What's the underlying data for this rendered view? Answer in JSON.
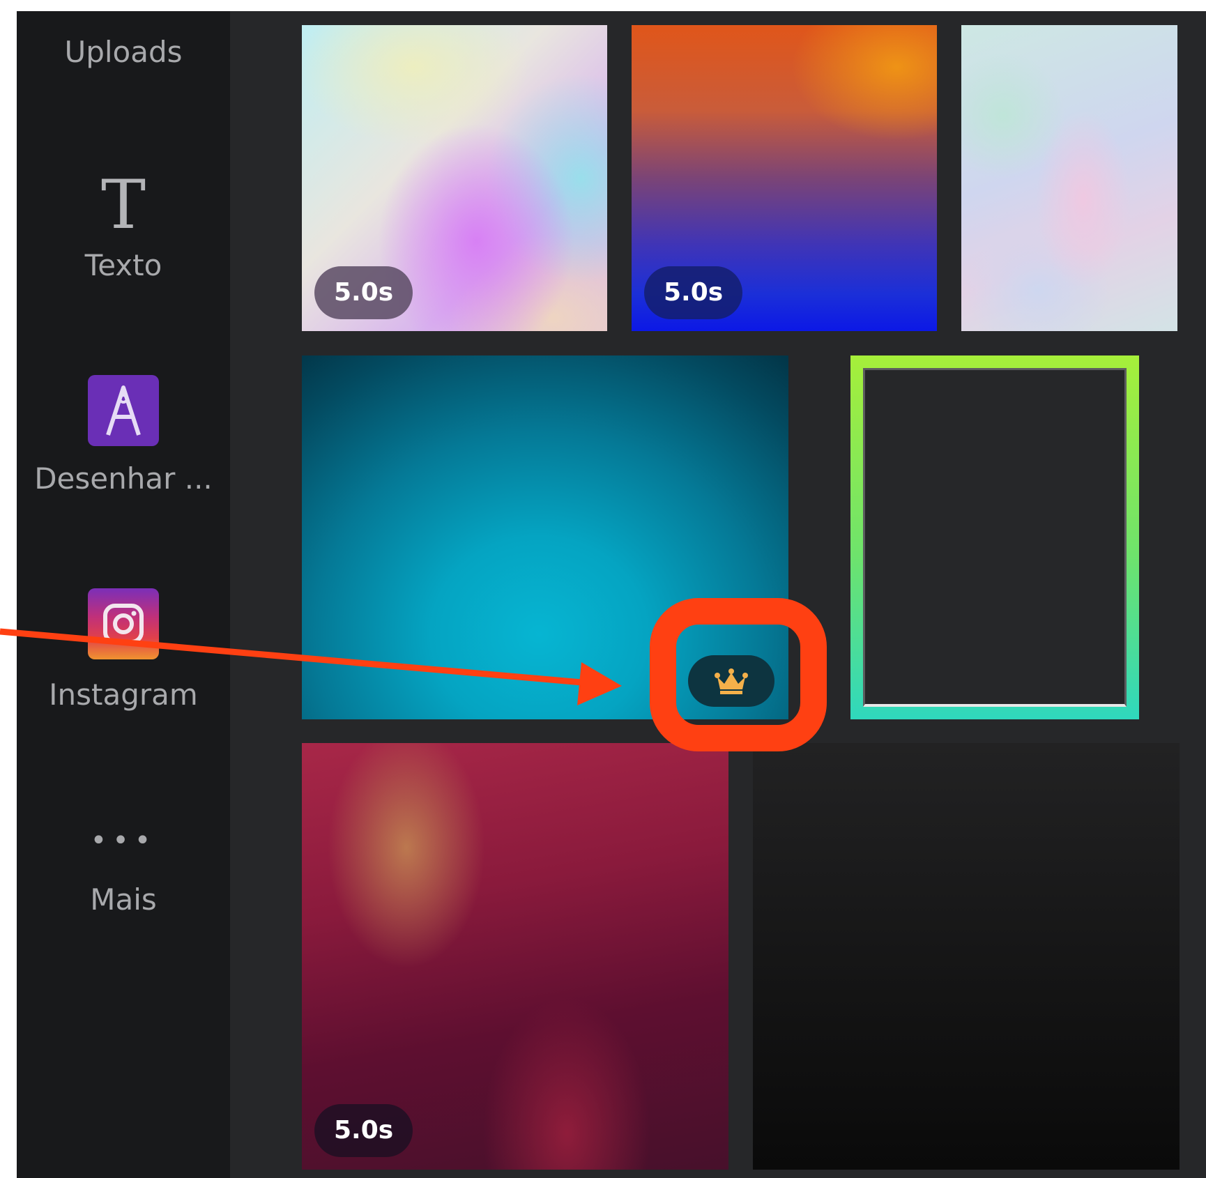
{
  "sidebar": {
    "items": [
      {
        "label": "Uploads",
        "icon": "upload-icon"
      },
      {
        "label": "Texto",
        "icon": "text-icon",
        "glyph": "T"
      },
      {
        "label": "Desenhar ...",
        "icon": "draw-icon",
        "glyph": "A"
      },
      {
        "label": "Instagram",
        "icon": "instagram-icon"
      },
      {
        "label": "Mais",
        "icon": "more-dots-icon",
        "glyph": "•••"
      }
    ]
  },
  "tiles": [
    {
      "duration": "5.0s"
    },
    {
      "duration": "5.0s"
    },
    {},
    {
      "premium_icon": "crown-icon"
    },
    {},
    {
      "duration": "5.0s"
    },
    {}
  ],
  "annotation": {
    "color": "#ff4012",
    "target": "premium-crown-badge"
  },
  "colors": {
    "panel_bg": "#262729",
    "sidebar_bg": "#18191b",
    "sidebar_text": "#a8a9ac",
    "crown": "#f4b04a"
  }
}
